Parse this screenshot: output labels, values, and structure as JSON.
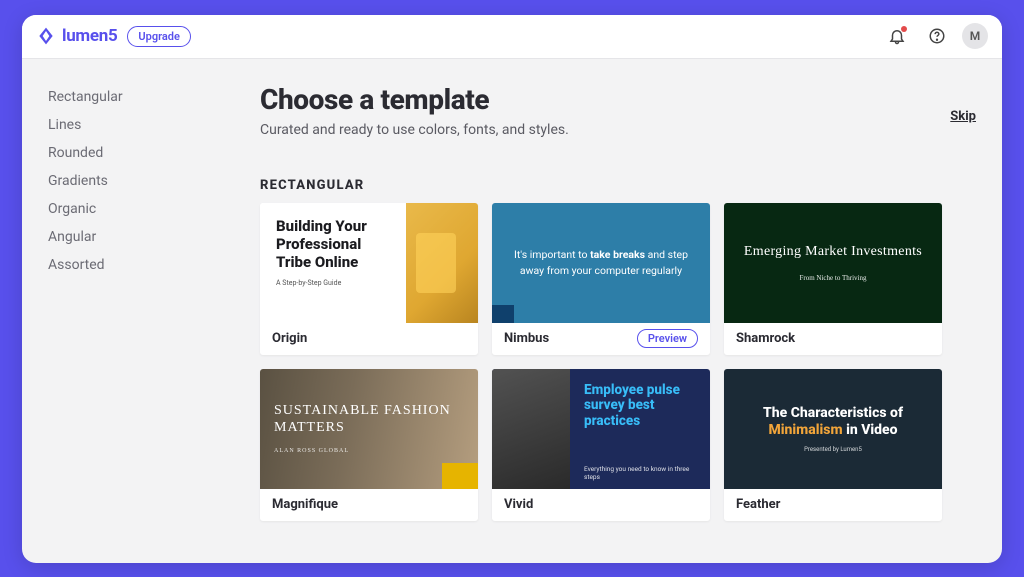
{
  "brand": {
    "name": "lumen5"
  },
  "topbar": {
    "upgrade_label": "Upgrade",
    "avatar_initial": "M"
  },
  "sidebar": {
    "items": [
      {
        "label": "Rectangular"
      },
      {
        "label": "Lines"
      },
      {
        "label": "Rounded"
      },
      {
        "label": "Gradients"
      },
      {
        "label": "Organic"
      },
      {
        "label": "Angular"
      },
      {
        "label": "Assorted"
      }
    ]
  },
  "page": {
    "title": "Choose a template",
    "subtitle": "Curated and ready to use colors, fonts, and styles.",
    "skip_label": "Skip"
  },
  "category": {
    "label": "Rectangular"
  },
  "templates_row1": [
    {
      "name": "Origin",
      "preview": {
        "headline": "Building Your Professional Tribe Online",
        "subline": "A Step-by-Step Guide"
      }
    },
    {
      "name": "Nimbus",
      "preview_button_label": "Preview",
      "preview": {
        "line_a": "It's important to",
        "line_bold": "take breaks",
        "line_b": "and step away from your computer regularly"
      }
    },
    {
      "name": "Shamrock",
      "preview": {
        "headline": "Emerging Market Investments",
        "subline": "From Niche to Thriving"
      }
    }
  ],
  "templates_row2": [
    {
      "name": "Magnifique",
      "preview": {
        "headline": "SUSTAINABLE FASHION MATTERS",
        "subline": "ALAN ROSS GLOBAL"
      }
    },
    {
      "name": "Vivid",
      "preview": {
        "headline": "Employee pulse survey best practices",
        "subline": "Everything you need to know in three steps"
      }
    },
    {
      "name": "Feather",
      "preview": {
        "line_a": "The Characteristics of",
        "accent": "Minimalism",
        "line_b": "in Video",
        "subline": "Presented by Lumen5"
      }
    }
  ]
}
